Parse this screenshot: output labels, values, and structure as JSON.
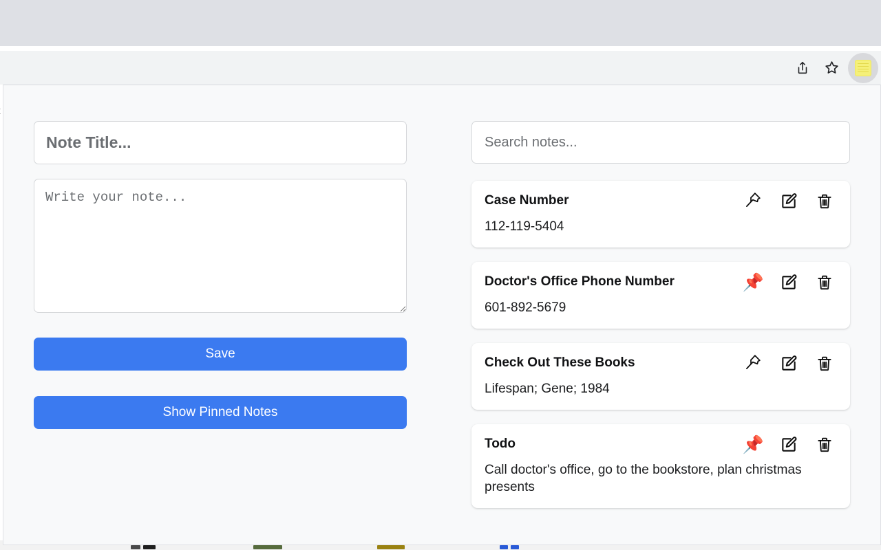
{
  "browser": {
    "toolbar": {
      "share_icon": "share-icon",
      "bookmark_icon": "star-icon",
      "extension_icon": "notepad-extension-icon"
    }
  },
  "underlay": {
    "text_fragment": "t"
  },
  "popup": {
    "compose": {
      "title_value": "",
      "title_placeholder": "Note Title...",
      "body_value": "",
      "body_placeholder": "Write your note...",
      "save_label": "Save",
      "show_pinned_label": "Show Pinned Notes"
    },
    "search": {
      "value": "",
      "placeholder": "Search notes..."
    },
    "actions": {
      "pin_icon": "pushpin-icon",
      "pinned_icon": "pushpin-filled-icon",
      "edit_icon": "edit-icon",
      "delete_icon": "trash-icon"
    },
    "notes": [
      {
        "title": "Case Number",
        "text": "112-119-5404",
        "pinned": false,
        "pin_glyph": ""
      },
      {
        "title": "Doctor's Office Phone Number",
        "text": "601-892-5679",
        "pinned": true,
        "pin_glyph": "📌"
      },
      {
        "title": "Check Out These Books",
        "text": "Lifespan; Gene; 1984",
        "pinned": false,
        "pin_glyph": ""
      },
      {
        "title": "Todo",
        "text": "Call doctor's office, go to the bookstore, plan christmas presents",
        "pinned": true,
        "pin_glyph": "📌"
      }
    ]
  },
  "colors": {
    "accent": "#3b7af0",
    "panel_background": "#f8f9fa",
    "card_background": "#ffffff",
    "tab_strip": "#dee0e5",
    "toolbar": "#f1f3f4",
    "pin_red": "#d93b30",
    "extension_yellow": "#f5f07a"
  }
}
